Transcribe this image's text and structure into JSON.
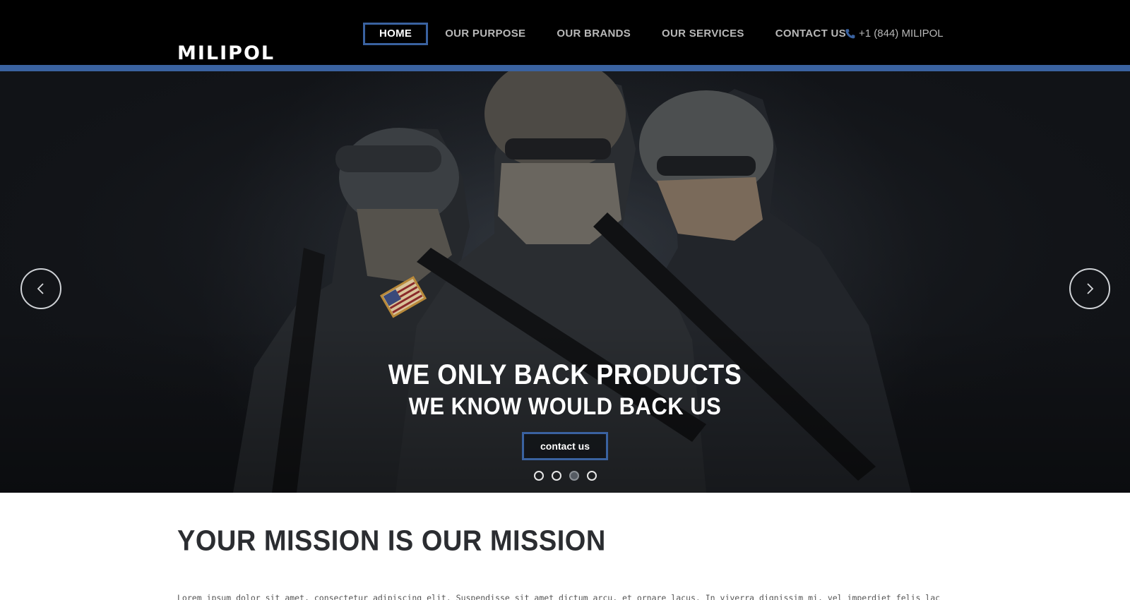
{
  "header": {
    "logo": "MILIPOL",
    "nav": [
      {
        "label": "HOME",
        "active": true
      },
      {
        "label": "OUR PURPOSE",
        "active": false
      },
      {
        "label": "OUR BRANDS",
        "active": false
      },
      {
        "label": "OUR SERVICES",
        "active": false
      },
      {
        "label": "CONTACT US",
        "active": false
      }
    ],
    "phone": "+1 (844) MILIPOL",
    "phone_icon": "phone-icon"
  },
  "hero": {
    "headline_line1": "WE ONLY BACK PRODUCTS",
    "headline_line2": "WE KNOW WOULD BACK US",
    "cta_label": "contact us",
    "prev_icon": "chevron-left-icon",
    "next_icon": "chevron-right-icon",
    "slide_count": 4,
    "active_slide": 3
  },
  "mission": {
    "title": "YOUR MISSION IS OUR MISSION",
    "text": "Lorem ipsum dolor sit amet, consectetur adipiscing elit. Suspendisse sit amet dictum arcu, et ornare lacus. In viverra dignissim mi, vel imperdiet felis lacinia"
  },
  "colors": {
    "header_bg": "#000000",
    "accent": "#3a62a0",
    "nav_text": "#b8b8b8",
    "title_text": "#2b2d31"
  }
}
